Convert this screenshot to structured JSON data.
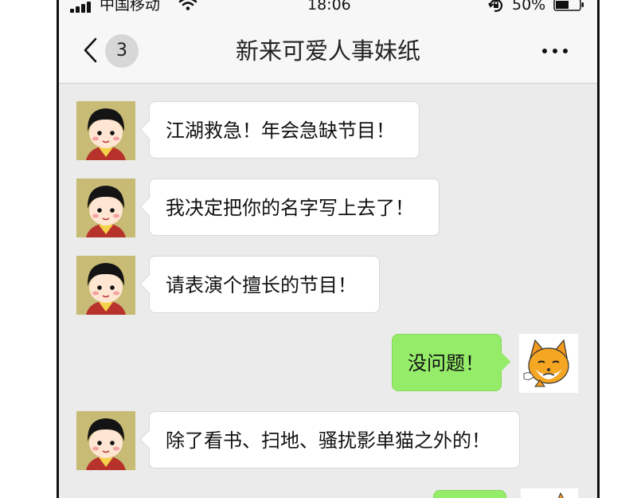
{
  "status_bar": {
    "carrier": "中国移动",
    "time": "18:06",
    "battery": "50%"
  },
  "header": {
    "unread_count": "3",
    "title": "新来可爱人事妹纸"
  },
  "messages": [
    {
      "from": "contact",
      "text": "江湖救急！年会急缺节目！"
    },
    {
      "from": "contact",
      "text": "我决定把你的名字写上去了！"
    },
    {
      "from": "contact",
      "text": "请表演个擅长的节目！"
    },
    {
      "from": "me",
      "text": "没问题！"
    },
    {
      "from": "contact",
      "text": "除了看书、扫地、骚扰影单猫之外的！"
    }
  ],
  "icons": {
    "back": "chevron-left-icon",
    "more": "more-dots-icon",
    "contact_avatar": "cartoon-girl-avatar",
    "my_avatar": "orange-cat-avatar"
  },
  "colors": {
    "chat_background": "#ebebeb",
    "outgoing_bubble": "#95ec69",
    "incoming_bubble": "#ffffff"
  }
}
